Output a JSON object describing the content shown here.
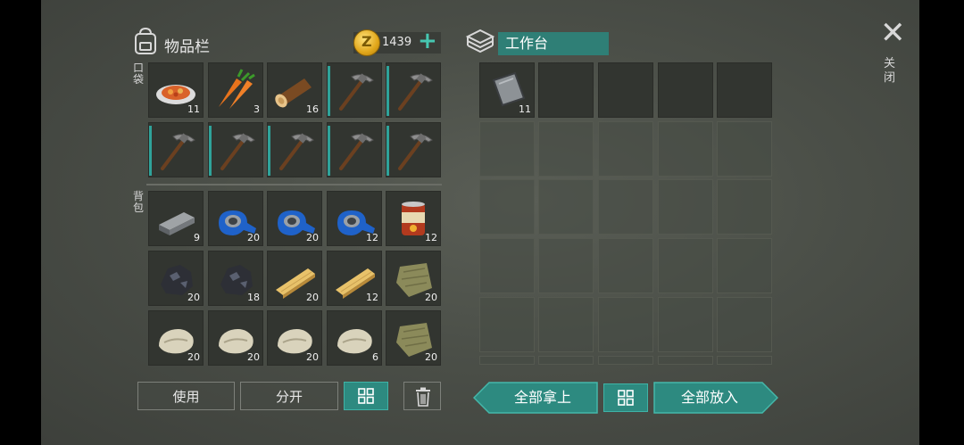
{
  "inventory": {
    "title": "物品栏",
    "coins": "1439",
    "plus": "+",
    "pocket_label": "口袋",
    "backpack_label": "背包",
    "pocket_slots": [
      {
        "item": "food-plate",
        "count": "11"
      },
      {
        "item": "carrot",
        "count": "3"
      },
      {
        "item": "log",
        "count": "16"
      },
      {
        "item": "pickaxe",
        "count": ""
      },
      {
        "item": "pickaxe",
        "count": ""
      },
      {
        "item": "pickaxe",
        "count": ""
      },
      {
        "item": "pickaxe",
        "count": ""
      },
      {
        "item": "pickaxe",
        "count": ""
      },
      {
        "item": "pickaxe",
        "count": ""
      },
      {
        "item": "pickaxe",
        "count": ""
      }
    ],
    "backpack_slots": [
      {
        "item": "iron-ingot",
        "count": "9"
      },
      {
        "item": "duct-tape",
        "count": "20"
      },
      {
        "item": "duct-tape",
        "count": "20"
      },
      {
        "item": "duct-tape",
        "count": "12"
      },
      {
        "item": "food-can",
        "count": "12"
      },
      {
        "item": "coal-ore",
        "count": "20"
      },
      {
        "item": "coal-ore",
        "count": "18"
      },
      {
        "item": "plank",
        "count": "20"
      },
      {
        "item": "plank",
        "count": "12"
      },
      {
        "item": "cloth",
        "count": "20"
      },
      {
        "item": "stone",
        "count": "20"
      },
      {
        "item": "stone",
        "count": "20"
      },
      {
        "item": "stone",
        "count": "20"
      },
      {
        "item": "stone",
        "count": "6"
      },
      {
        "item": "cloth",
        "count": "20"
      }
    ],
    "use_label": "使用",
    "split_label": "分开"
  },
  "workbench": {
    "title": "工作台",
    "slots": [
      {
        "item": "sheet-metal",
        "count": "11"
      }
    ],
    "take_all_label": "全部拿上",
    "put_all_label": "全部放入"
  },
  "close_label": "关闭",
  "colors": {
    "accent": "#2d8a80",
    "accent_light": "#46c7b1",
    "coin": "#e0a61a"
  }
}
